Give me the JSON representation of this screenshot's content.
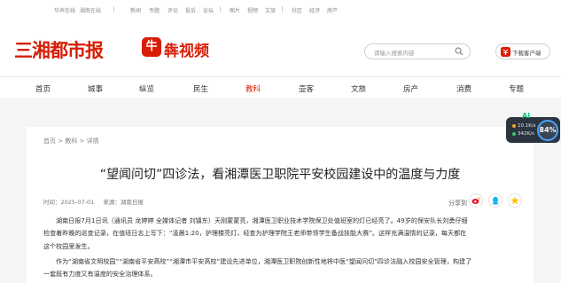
{
  "topbar": {
    "links": [
      "华声在线",
      "湖南在线",
      "新闻",
      "专题",
      "评论",
      "投诉",
      "论坛",
      "图片",
      "视频",
      "文旅",
      "社区",
      "经济",
      "房产"
    ]
  },
  "brand": {
    "logo_text": "三湘都市报",
    "video_badge": "牛",
    "video_text": "犇视频"
  },
  "search": {
    "placeholder": "请输入搜索内容"
  },
  "download": {
    "label": "下载客户端"
  },
  "nav": {
    "items": [
      "首页",
      "城事",
      "纵览",
      "民生",
      "教科",
      "壶客",
      "文旅",
      "房产",
      "消费",
      "专题"
    ],
    "active_index": 4
  },
  "breadcrumb": "首页 > 教科 > 详情",
  "article": {
    "title": "“望闻问切”四诊法，看湘潭医卫职院平安校园建设中的温度与力度",
    "time_label": "时间：",
    "time_value": "2025-07-01",
    "source_label": "来源：",
    "source_value": "湖南日报",
    "share_label": "分享到",
    "para1_lines": [
      "湖南日报7月1日讯（通讯员 龙婷婷 全媒体记者 刘镇东）天刚蒙蒙亮，湘潭医卫职业技术学院保卫处值班室的灯已经亮了。49岁的保安队长刘勇仔细",
      "检查着昨晚的巡查记录，在值班日志上写下：“凌晨1:20，护理楼亮灯，经查为护理学院王老师带领学生备战技能大赛”。这样充满温情的记录，每天都在",
      "这个校园里发生。"
    ],
    "para2_lines": [
      "作为“湖南省文明校园”“湖南省平安高校”“湘潭市平安高校”建设先进单位，湘潭医卫职院创新性地将中医“望闻问切”四诊法融入校园安全管理，构建了",
      "一套既有力度又有温度的安全治理体系。"
    ]
  },
  "widget": {
    "ai": "AI",
    "up": "10.1K/s",
    "down": "342K/s",
    "gauge": "84%"
  },
  "colors": {
    "brand_red": "#d81e06",
    "page_bg": "#f5f5f5"
  }
}
